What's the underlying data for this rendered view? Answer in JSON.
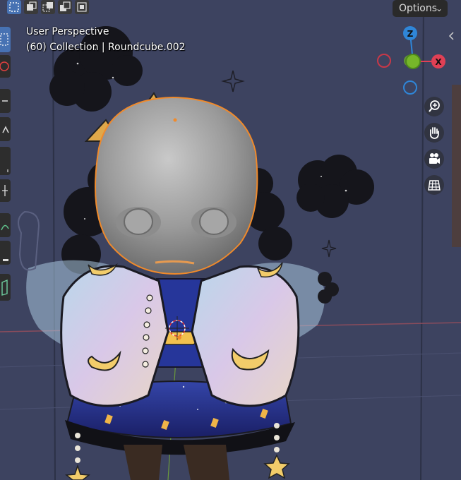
{
  "header": {
    "options_label": "Options"
  },
  "viewport": {
    "perspective_label": "User Perspective",
    "collection_label": "(60) Collection | Roundcube.002"
  },
  "gizmo": {
    "z_label": "Z",
    "x_label": "X",
    "colors": {
      "z": "#2f86d8",
      "x": "#e04055",
      "y": "#76b62a"
    }
  },
  "icons": {
    "select_box": "select-box-icon",
    "zoom": "zoom-icon",
    "pan": "hand-icon",
    "camera": "camera-icon",
    "grid": "grid-icon"
  },
  "colors": {
    "viewport_bg": "#3d4360",
    "selection_outline": "#f08a2b",
    "active_tool": "#4772b3"
  }
}
